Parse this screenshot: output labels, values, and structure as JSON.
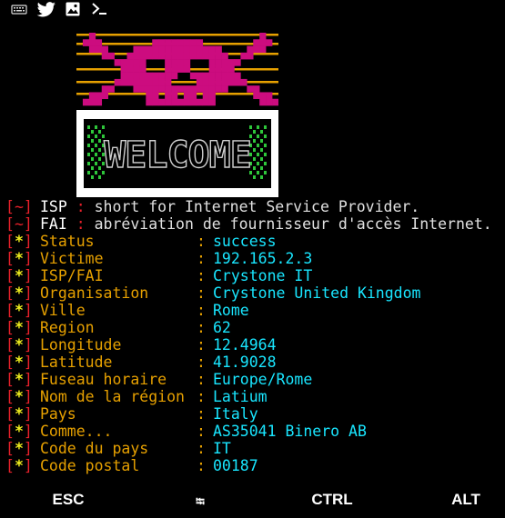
{
  "statusbar": {
    "icons": [
      "keyboard-icon",
      "twitter-bird-icon",
      "image-icon",
      "terminal-prompt-icon"
    ]
  },
  "banner": {
    "logo_text": "WELCOME",
    "colors": {
      "skull": "#cc0c7f",
      "stripes": "#e6a000",
      "box_bg": "#ffffff",
      "box_inner": "#000000",
      "pattern": "#2ec53a"
    }
  },
  "terminal": {
    "info_lines": [
      {
        "marker": "~",
        "key": "ISP",
        "text": "short for Internet Service Provider."
      },
      {
        "marker": "~",
        "key": "FAI",
        "text": "abréviation de fournisseur d'accès Internet."
      }
    ],
    "separator": ":",
    "fields": [
      {
        "label": "Status",
        "value": "success"
      },
      {
        "label": "Victime",
        "value": "192.165.2.3"
      },
      {
        "label": "ISP/FAI",
        "value": "Crystone IT"
      },
      {
        "label": "Organisation",
        "value": "Crystone United Kingdom"
      },
      {
        "label": "Ville",
        "value": "Rome"
      },
      {
        "label": "Region",
        "value": "62"
      },
      {
        "label": "Longitude",
        "value": "12.4964"
      },
      {
        "label": "Latitude",
        "value": "41.9028"
      },
      {
        "label": "Fuseau horaire",
        "value": "Europe/Rome"
      },
      {
        "label": "Nom de la région",
        "value": "Latium"
      },
      {
        "label": "Pays",
        "value": "Italy"
      },
      {
        "label": "Comme...",
        "value": "AS35041 Binero AB"
      },
      {
        "label": "Code du pays",
        "value": "IT"
      },
      {
        "label": "Code postal",
        "value": "00187"
      }
    ],
    "field_marker": "*"
  },
  "keybar": {
    "keys": [
      "ESC",
      "⭾",
      "CTRL",
      "ALT"
    ]
  },
  "colors": {
    "background": "#000000",
    "bracket": "#e8202a",
    "star": "#f0f01e",
    "label": "#e6a000",
    "value": "#19e6ff"
  }
}
